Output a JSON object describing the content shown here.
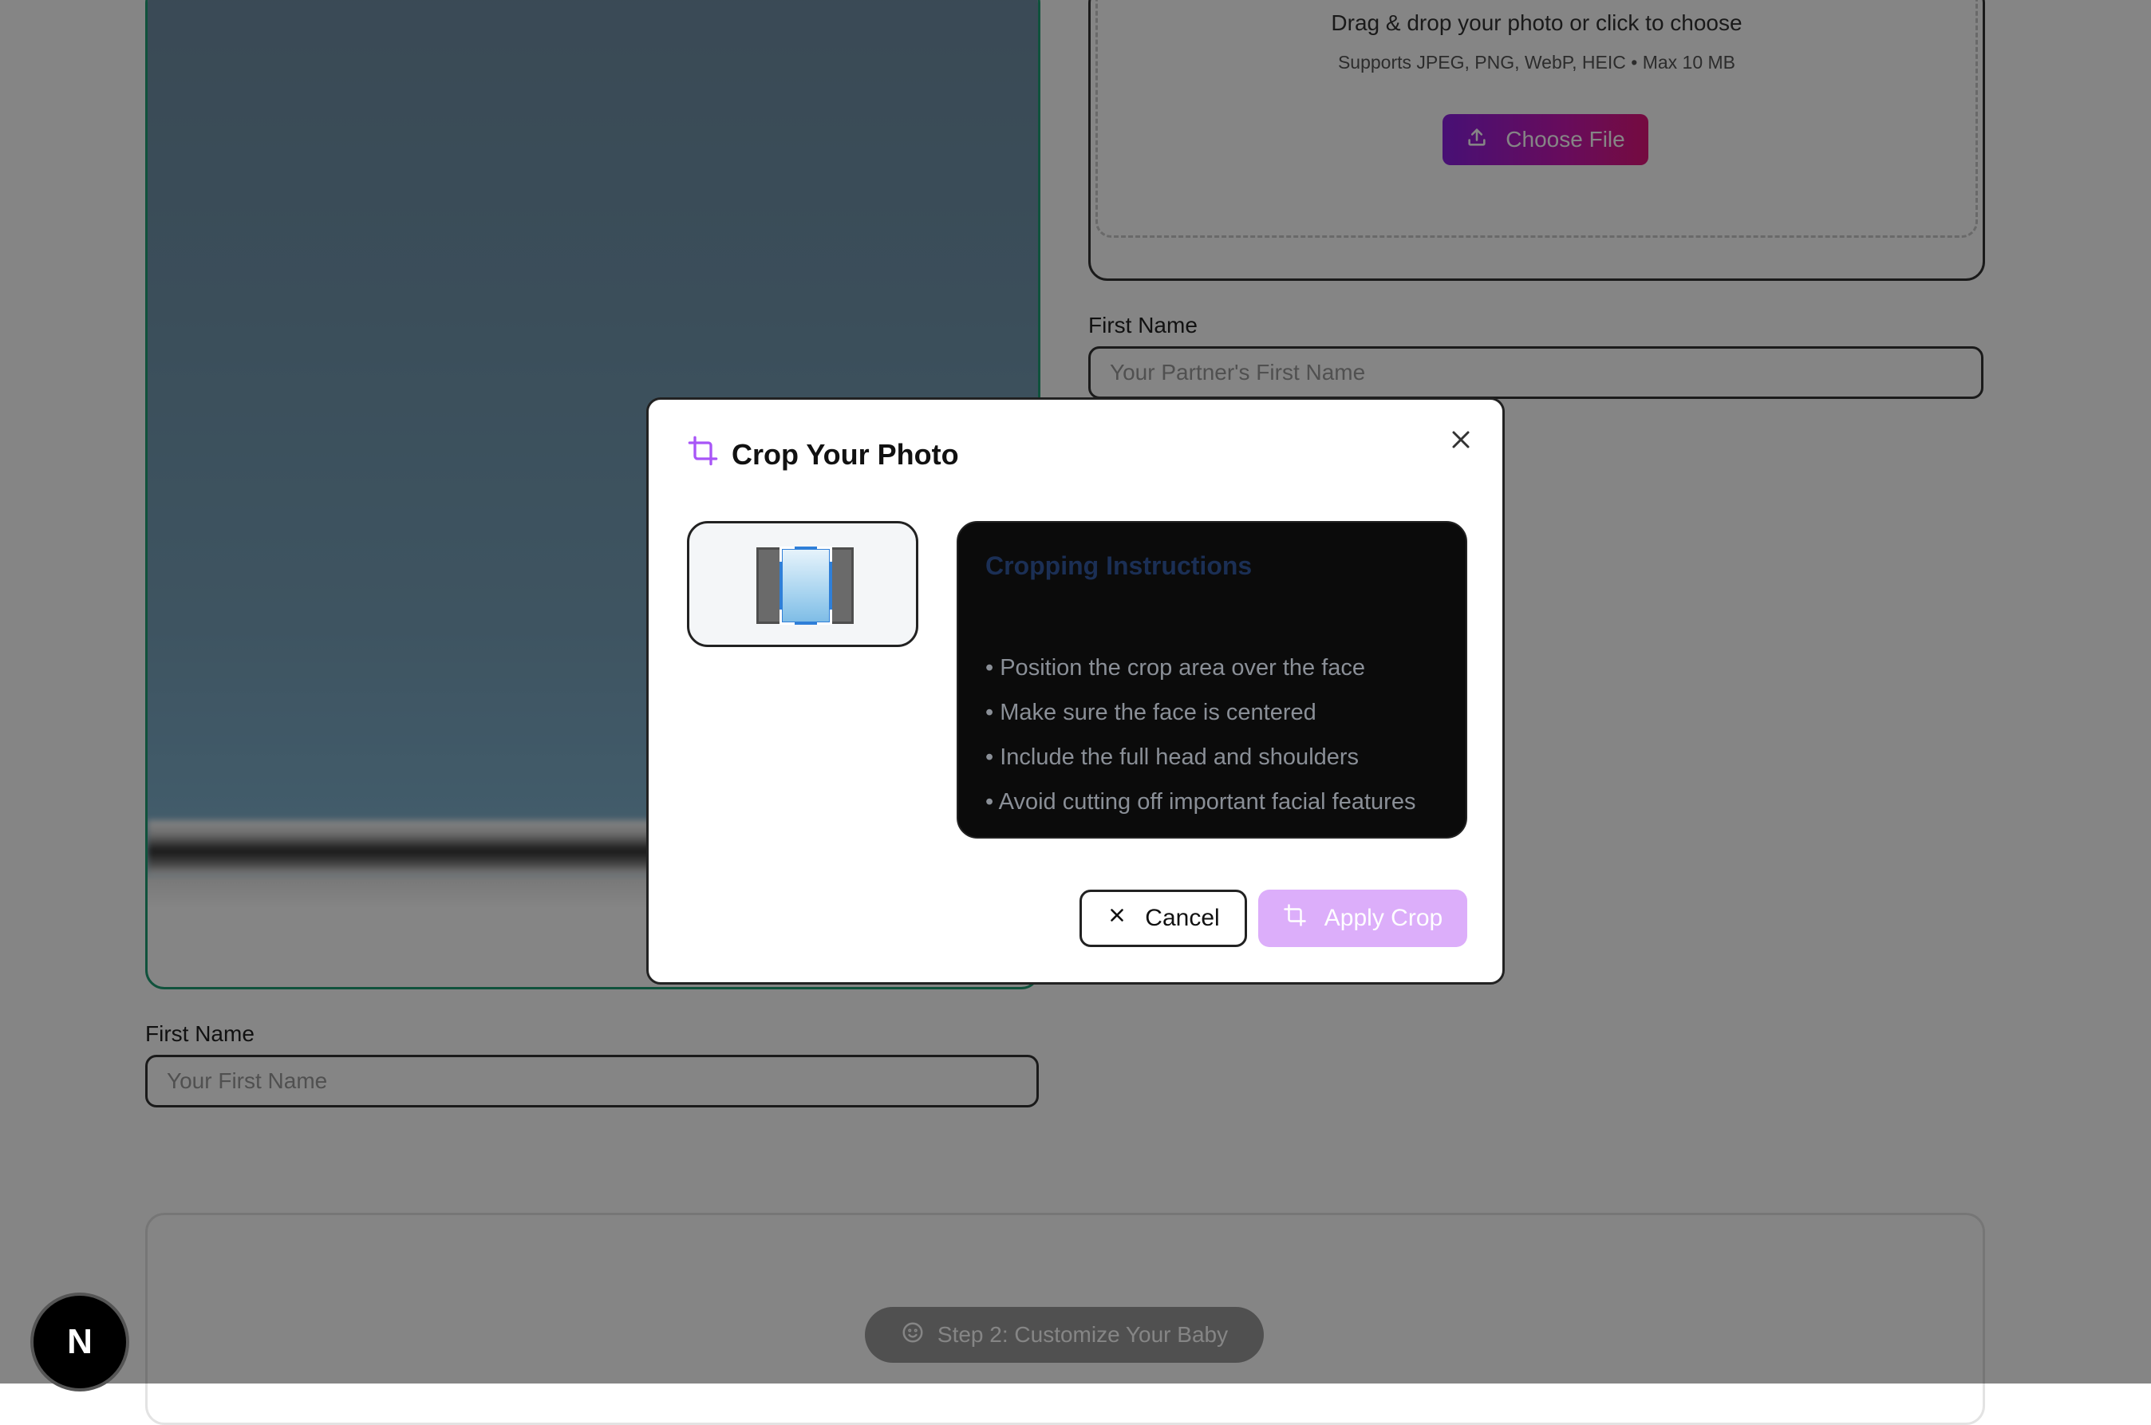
{
  "upload": {
    "title": "Drag & drop your photo or click to choose",
    "subtitle": "Supports JPEG, PNG, WebP, HEIC • Max 10 MB",
    "button_label": "Choose File"
  },
  "partner_field": {
    "label": "First Name",
    "placeholder": "Your Partner's First Name"
  },
  "user_field": {
    "label": "First Name",
    "placeholder": "Your First Name"
  },
  "step": {
    "button_label": "Step 2: Customize Your Baby"
  },
  "badge": {
    "letter": "N"
  },
  "modal": {
    "title": "Crop Your Photo",
    "instructions_title": "Cropping Instructions",
    "instructions": [
      "Position the crop area over the face",
      "Make sure the face is centered",
      "Include the full head and shoulders",
      "Avoid cutting off important facial features"
    ],
    "cancel_label": "Cancel",
    "apply_label": "Apply Crop"
  },
  "colors": {
    "accent_purple": "#a855f7",
    "apply_disabled": "#dcaefa",
    "crop_border": "#2f7fd8"
  },
  "icons": [
    "upload-icon",
    "crop-icon",
    "close-icon",
    "x-icon",
    "smile-icon"
  ]
}
